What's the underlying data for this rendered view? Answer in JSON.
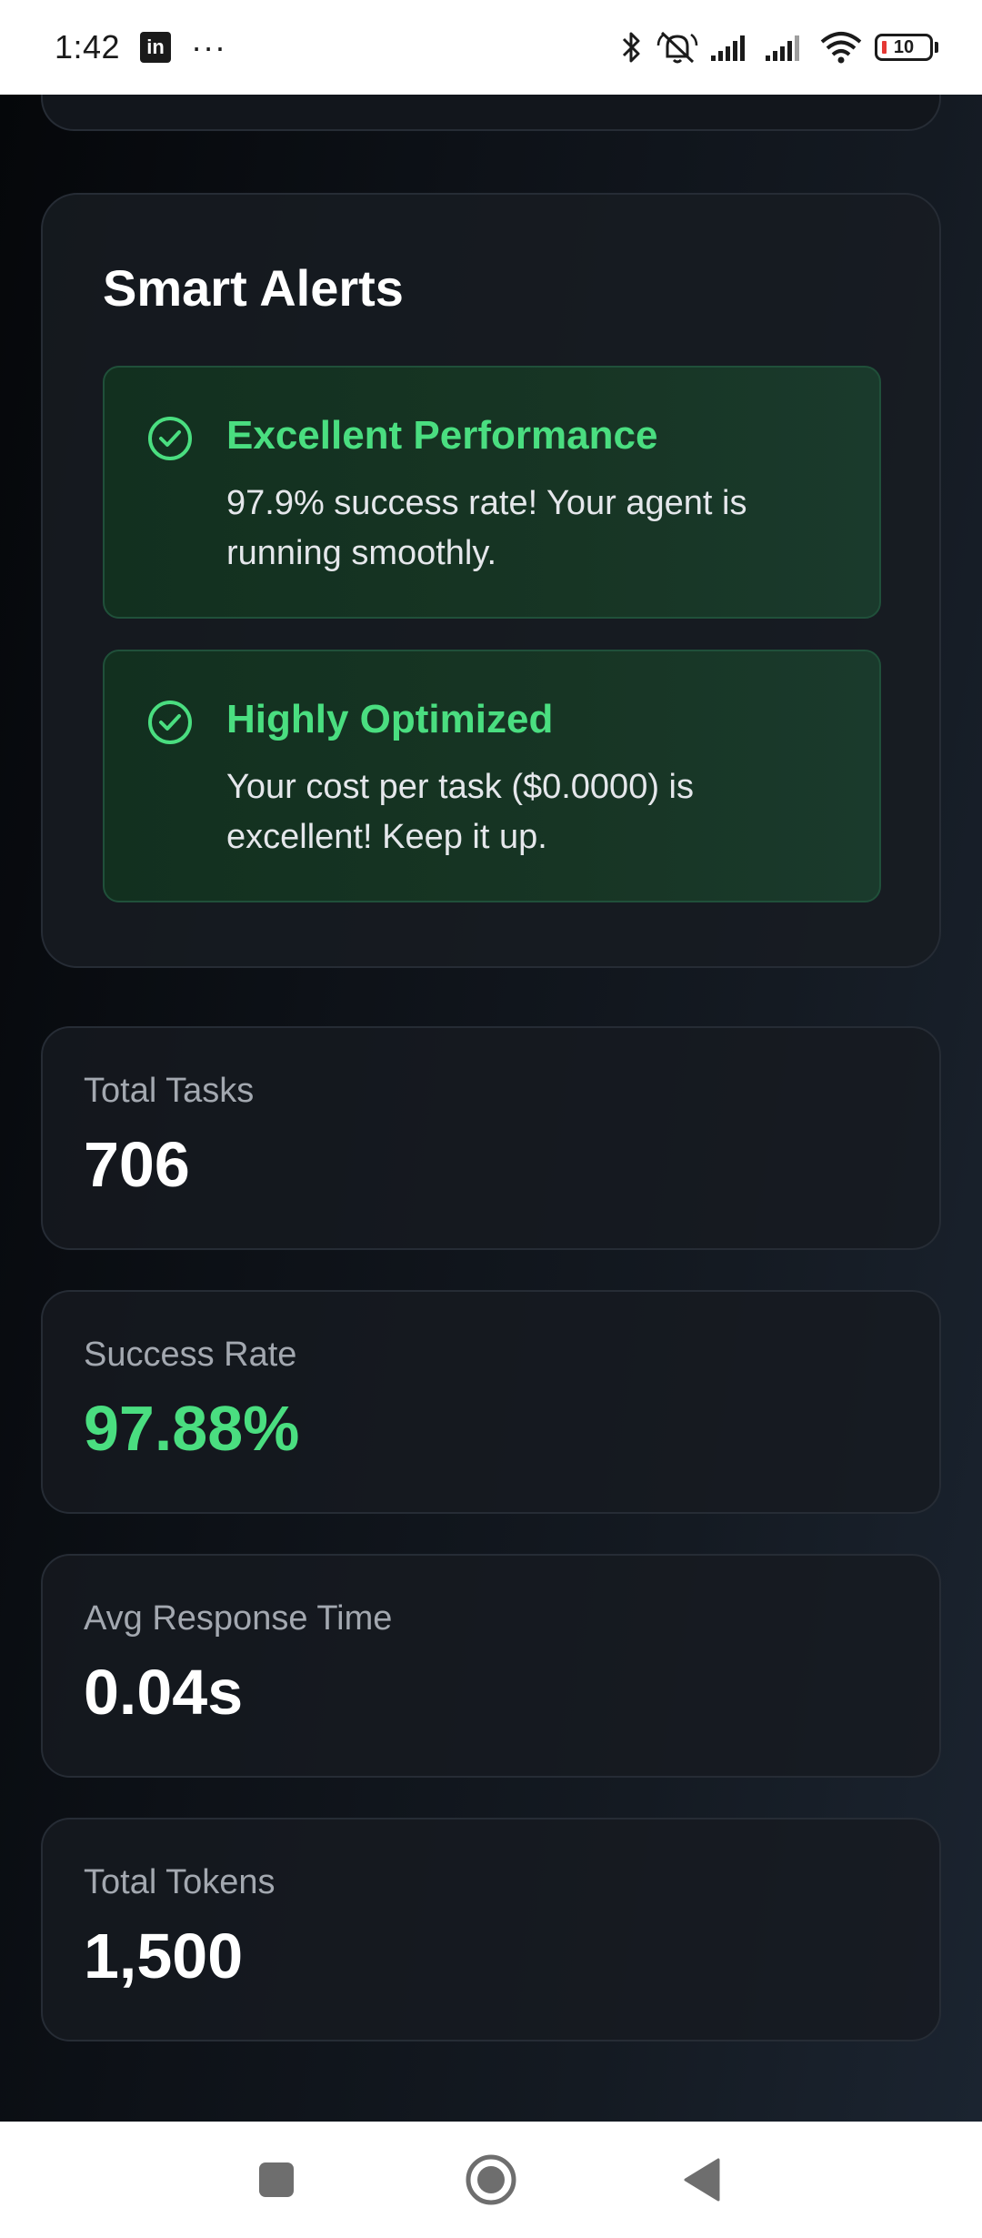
{
  "status_bar": {
    "time": "1:42",
    "battery_level": "10",
    "icons": [
      "linkedin-icon",
      "more-icon",
      "bluetooth-icon",
      "muted-bell-icon",
      "signal-icon",
      "signal-icon",
      "wifi-icon",
      "battery-icon"
    ]
  },
  "smart_alerts": {
    "title": "Smart Alerts",
    "alerts": [
      {
        "heading": "Excellent Performance",
        "message": "97.9% success rate! Your agent is running smoothly.",
        "icon": "check-circle-icon"
      },
      {
        "heading": "Highly Optimized",
        "message": "Your cost per task ($0.0000) is excellent! Keep it up.",
        "icon": "check-circle-icon"
      }
    ]
  },
  "stats": [
    {
      "label": "Total Tasks",
      "value": "706"
    },
    {
      "label": "Success Rate",
      "value": "97.88%"
    },
    {
      "label": "Avg Response Time",
      "value": "0.04s"
    },
    {
      "label": "Total Tokens",
      "value": "1,500"
    }
  ],
  "colors": {
    "background": "#0a0d12",
    "accent_green": "#4ade80",
    "card_border": "#262c35",
    "text_muted": "#a3a8b0"
  },
  "nav_bar": {
    "buttons": [
      "recents-icon",
      "home-icon",
      "back-icon"
    ]
  }
}
